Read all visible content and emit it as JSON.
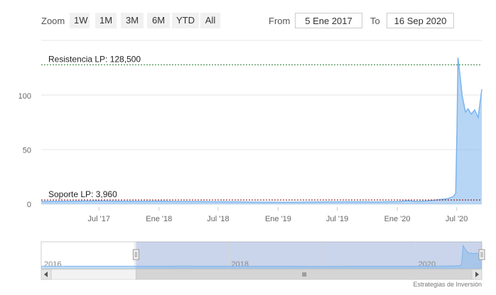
{
  "toolbar": {
    "zoom_label": "Zoom",
    "buttons": [
      "1W",
      "1M",
      "3M",
      "6M",
      "YTD",
      "All"
    ],
    "from_label": "From",
    "from_value": "5 Ene 2017",
    "to_label": "To",
    "to_value": "16 Sep 2020"
  },
  "credits": "Estrategias de Inversión",
  "colors": {
    "line": "#7cb5ec",
    "resistance": "#2e7d32",
    "support": "#8b0000"
  },
  "chart_data": {
    "type": "area",
    "title": "",
    "xlabel": "",
    "ylabel": "",
    "ylim": [
      0,
      130
    ],
    "grid": true,
    "x_ticks": [
      "Jul '17",
      "Ene '18",
      "Jul '18",
      "Ene '19",
      "Jul '19",
      "Ene '20",
      "Jul '20"
    ],
    "y_ticks": [
      "0",
      "50",
      "100"
    ],
    "y_tick_values": [
      0,
      50,
      100
    ],
    "annotations": [
      {
        "label": "Resistencia LP: 128,500",
        "value": 128.5
      },
      {
        "label": "Soporte LP: 3,960",
        "value": 3.96
      }
    ],
    "series": [
      {
        "x": [
          "2017-01-05",
          "2017-03-01",
          "2017-05-01",
          "2017-07-01",
          "2017-09-01",
          "2017-11-01",
          "2018-01-01",
          "2018-03-01",
          "2018-05-01",
          "2018-07-01",
          "2018-09-01",
          "2018-11-01",
          "2019-01-01",
          "2019-03-01",
          "2019-05-01",
          "2019-07-01",
          "2019-09-01",
          "2019-11-01",
          "2020-01-01",
          "2020-02-01",
          "2020-03-01",
          "2020-04-01",
          "2020-05-01",
          "2020-06-01",
          "2020-06-20",
          "2020-06-28",
          "2020-07-02",
          "2020-07-05",
          "2020-07-10",
          "2020-07-18",
          "2020-07-28",
          "2020-08-05",
          "2020-08-15",
          "2020-08-25",
          "2020-09-05",
          "2020-09-10",
          "2020-09-16"
        ],
        "values": [
          2.6,
          2.7,
          2.9,
          3.0,
          2.8,
          2.7,
          2.9,
          2.5,
          2.4,
          2.3,
          2.2,
          1.9,
          1.8,
          1.9,
          2.1,
          2.2,
          2.2,
          2.1,
          2.4,
          3.2,
          2.6,
          3.0,
          4.0,
          5.0,
          7.0,
          10.0,
          70.0,
          135.0,
          122.0,
          100.0,
          85.0,
          88.0,
          83.0,
          87.0,
          80.0,
          92.0,
          106.0
        ]
      }
    ],
    "navigator": {
      "year_labels": [
        "2016",
        "2018",
        "2020"
      ],
      "selected_from": "2017-01-05",
      "selected_to": "2020-09-16"
    }
  }
}
